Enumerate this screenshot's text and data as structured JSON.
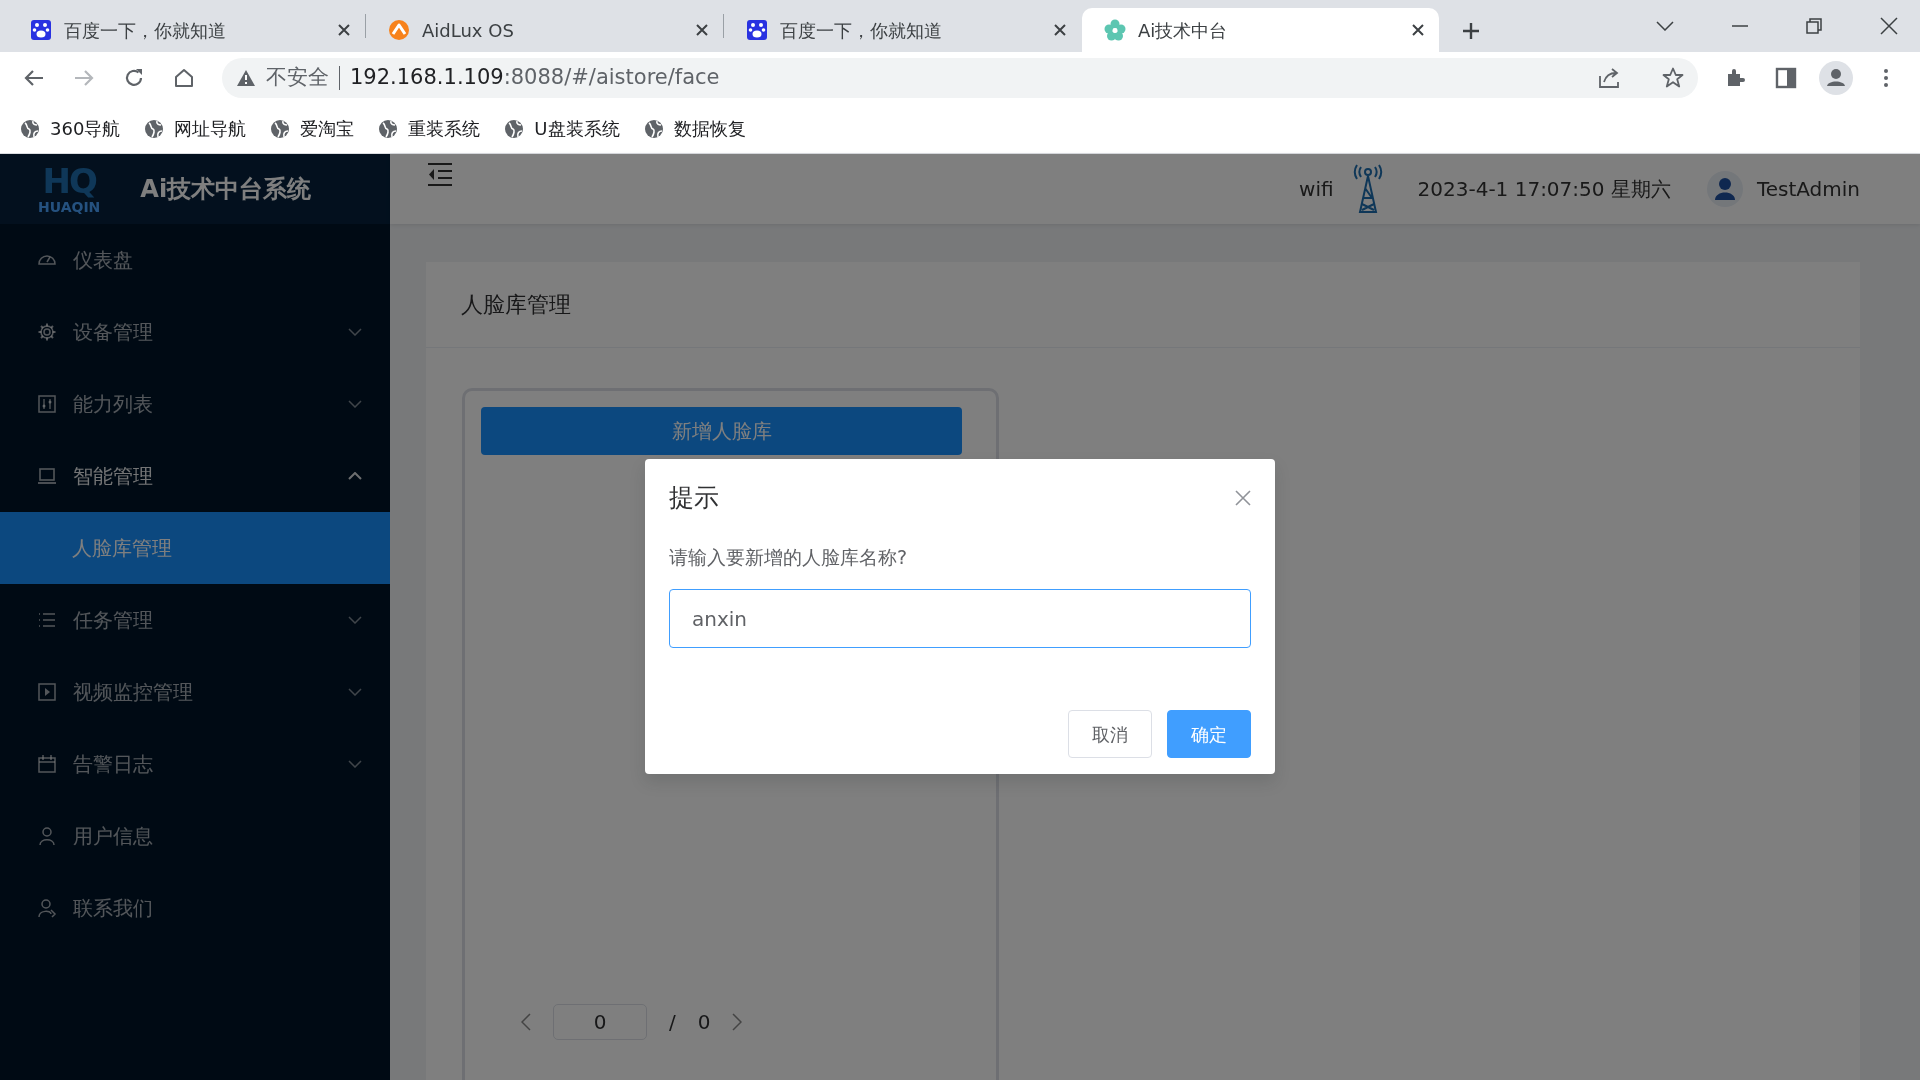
{
  "browser": {
    "tabs": [
      {
        "title": "百度一下，你就知道",
        "selected": false
      },
      {
        "title": "AidLux OS",
        "selected": false
      },
      {
        "title": "百度一下，你就知道",
        "selected": false
      },
      {
        "title": "Ai技术中台",
        "selected": true
      }
    ],
    "address": {
      "security": "不安全",
      "host": "192.168.1.109",
      "path": ":8088/#/aistore/face"
    },
    "bookmarks": [
      "360导航",
      "网址导航",
      "爱淘宝",
      "重装系统",
      "U盘装系统",
      "数据恢复"
    ]
  },
  "app": {
    "logo": {
      "mark": "HQ",
      "name": "HUAQIN"
    },
    "brand": "Ai技术中台系统",
    "header": {
      "network": "wifi",
      "datetime": "2023-4-1 17:07:50 星期六",
      "user": "TestAdmin"
    },
    "sidebar": {
      "items": [
        {
          "label": "仪表盘",
          "kind": "item"
        },
        {
          "label": "设备管理",
          "kind": "group",
          "expanded": false
        },
        {
          "label": "能力列表",
          "kind": "group",
          "expanded": false
        },
        {
          "label": "智能管理",
          "kind": "group",
          "expanded": true,
          "children": [
            {
              "label": "人脸库管理",
              "selected": true
            }
          ]
        },
        {
          "label": "任务管理",
          "kind": "group",
          "expanded": false
        },
        {
          "label": "视频监控管理",
          "kind": "group",
          "expanded": false
        },
        {
          "label": "告警日志",
          "kind": "group",
          "expanded": false
        },
        {
          "label": "用户信息",
          "kind": "item"
        },
        {
          "label": "联系我们",
          "kind": "item"
        }
      ]
    },
    "page": {
      "title": "人脸库管理",
      "add_button": "新增人脸库",
      "pager": {
        "page": "0",
        "separator": "/",
        "total": "0"
      }
    }
  },
  "dialog": {
    "title": "提示",
    "message": "请输入要新增的人脸库名称?",
    "input_value": "anxin",
    "buttons": [
      {
        "label": "取消",
        "kind": "secondary"
      },
      {
        "label": "确定",
        "kind": "primary"
      }
    ]
  }
}
